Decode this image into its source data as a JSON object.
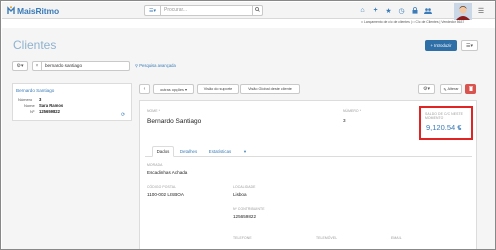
{
  "app": {
    "name": "MaisRitmo"
  },
  "search": {
    "placeholder": "Procurar..."
  },
  "header": {
    "top_links": "□ Lançamento de c/c de clientes | □ C/c de Clientes | Vendedor 5637",
    "nav_icons": [
      "home-icon",
      "plus-icon",
      "star-icon",
      "clock-icon",
      "lock-icon",
      "users-icon"
    ]
  },
  "page": {
    "title": "Clientes",
    "new_button": "+ Introduzir",
    "filter_value": "bernardo santiago",
    "advanced_search": "Pesquisa avançada"
  },
  "card": {
    "title": "Bernardo Santiago",
    "rows": [
      {
        "label": "Número",
        "value": "3"
      },
      {
        "label": "Nome",
        "value": "Sara Ramos"
      },
      {
        "label": "Nº",
        "value": "125659822"
      }
    ]
  },
  "toolbar": {
    "other_options": "outras opções ▾",
    "support_view": "Visão do suporte",
    "global_view": "Visão Global deste cliente",
    "edit": "Alterar"
  },
  "detail": {
    "name_label": "Nome *",
    "name_value": "Bernardo Santiago",
    "number_label": "Número *",
    "number_value": "3",
    "balance_label": "Saldo de c/c neste momento",
    "balance_value": "9,120.54 €",
    "tabs": [
      {
        "label": "Dados",
        "active": true
      },
      {
        "label": "Detalhes",
        "active": false
      },
      {
        "label": "Estatísticas",
        "active": false
      },
      {
        "label": "▾",
        "active": false
      }
    ],
    "fields": {
      "address_label": "Morada",
      "address_value": "Escadinhas Achada",
      "postal_label": "Código postal",
      "postal_value": "1100-002 LISBOA",
      "locality_label": "Localidade",
      "locality_value": "Lisboa",
      "taxid_label": "Nº contribuinte",
      "taxid_value": "125659822",
      "phone_label": "Telefone",
      "mobile_label": "Telemóvel",
      "email_label": "Email"
    }
  },
  "colors": {
    "accent": "#3a7bb8",
    "primary_button": "#2f6fa8",
    "danger": "#d9534f",
    "highlight_border": "#e02424"
  }
}
